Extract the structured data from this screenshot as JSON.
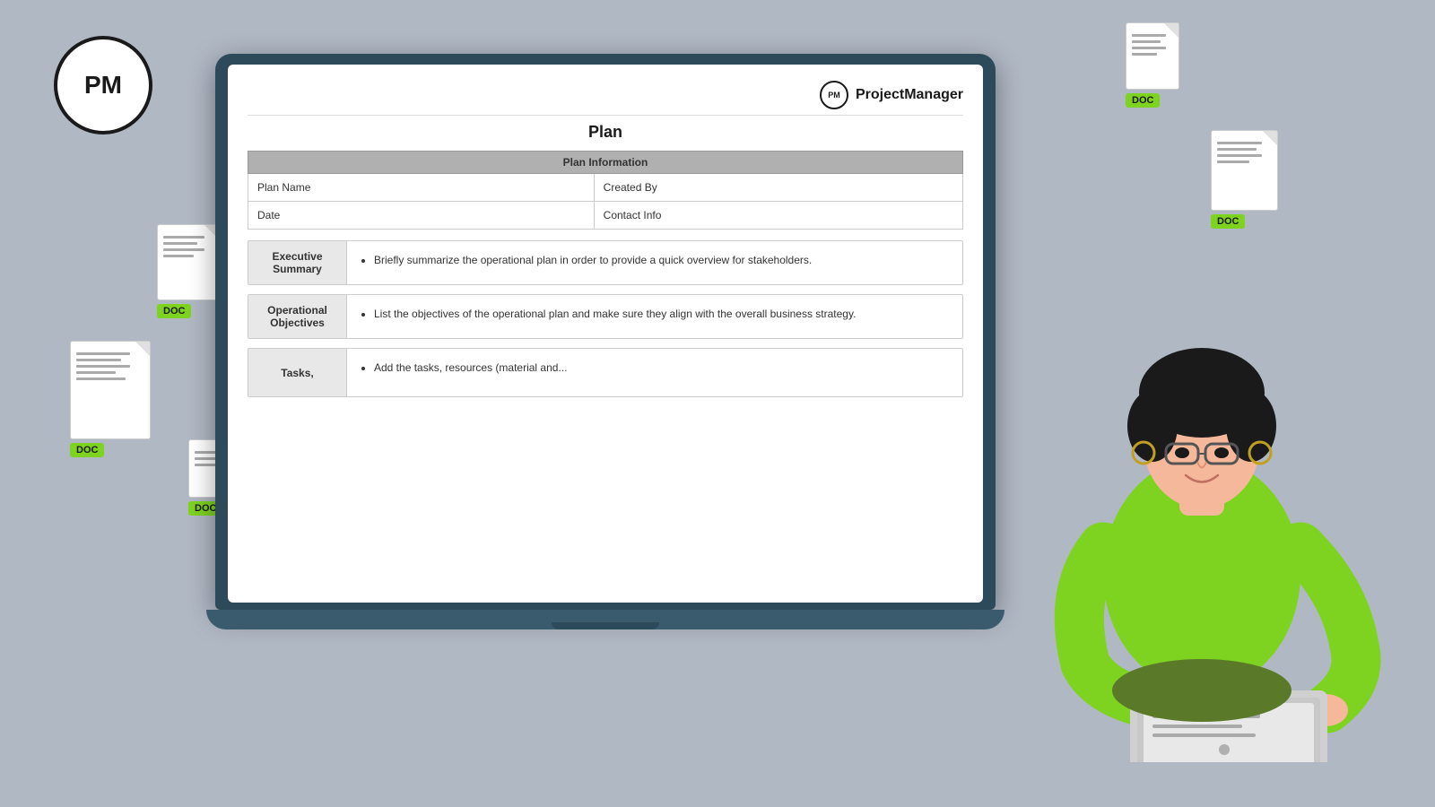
{
  "logo": {
    "text": "PM"
  },
  "doc_badges": [
    {
      "id": "doc1",
      "label": "DOC",
      "position": "top-right"
    },
    {
      "id": "doc2",
      "label": "DOC",
      "position": "right-mid"
    },
    {
      "id": "doc3",
      "label": "DOC",
      "position": "left-1"
    },
    {
      "id": "doc4",
      "label": "DOC",
      "position": "left-2"
    },
    {
      "id": "doc5",
      "label": "DOC",
      "position": "left-3"
    }
  ],
  "brand": {
    "icon_text": "PM",
    "name": "ProjectManager"
  },
  "document": {
    "title": "Plan",
    "plan_table": {
      "header": "Plan Information",
      "rows": [
        {
          "col1": "Plan Name",
          "col2": "Created By"
        },
        {
          "col1": "Date",
          "col2": "Contact Info"
        }
      ]
    },
    "sections": [
      {
        "label": "Executive Summary",
        "bullet": "Briefly summarize the operational plan in order to provide a quick overview for stakeholders."
      },
      {
        "label": "Operational Objectives",
        "bullet": "List the objectives of the operational plan and make sure they align with the overall business strategy."
      },
      {
        "label": "Tasks,",
        "bullet": "Add the tasks, resources (material and..."
      }
    ]
  }
}
